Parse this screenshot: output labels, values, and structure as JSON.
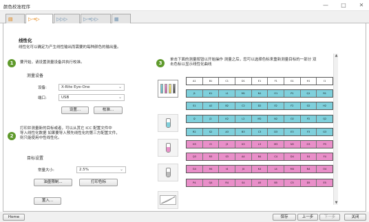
{
  "window": {
    "title": "颜色校准程序",
    "min": "—",
    "max": "□",
    "close": "✕"
  },
  "tabs": [
    {
      "name": "tab-1",
      "text": "▤"
    },
    {
      "name": "tab-2",
      "text": "▷→▷"
    },
    {
      "name": "tab-3",
      "text": "▷▷▷"
    },
    {
      "name": "tab-4",
      "text": "▷→▷▷"
    },
    {
      "name": "tab-5",
      "text": "▦"
    }
  ],
  "page": {
    "title": "线性化",
    "description": "线性化可以确定为产生线性输出而需要的每种颜色的输出量。"
  },
  "step1": {
    "num": "1",
    "text": "要开始，请设置测量设备并执行校准。",
    "section": "测量设备",
    "device_label": "设备:",
    "device_value": "X-Rite Eye-One",
    "port_label": "端口:",
    "port_value": "USB",
    "settings_btn": "设置...",
    "calibrate_btn": "校准..."
  },
  "step2": {
    "num": "2",
    "lines": [
      "打印并测量新的目标或者，可以从其它 ICC 配置文件中",
      "导入线性化数据 如果要导入预先线性化的第三方配置文件，",
      "则只能使用中性线性化。"
    ],
    "section": "目标设置",
    "size_label": "常量大小:",
    "size_value": "2.5%",
    "page_setup_btn": "油墨限制...",
    "print_btn": "打印色标",
    "import_btn": "置入..."
  },
  "step3": {
    "num": "3",
    "lines": [
      "单击下面的测量按钮以开始操作 测量之后，您可以选择色标来重新测量目标的一部分 双",
      "击色标以显示线性化曲线"
    ]
  },
  "target": {
    "rows": [
      {
        "color": "#ffffff",
        "cells": [
          "A1",
          "B1",
          "C1",
          "D1",
          "E1",
          "F1",
          "G1",
          "H1",
          "I1"
        ]
      },
      {
        "color": "#7fd0dc",
        "cells": [
          "J1",
          "K1",
          "L1",
          "M1",
          "N1",
          "O1",
          "P1",
          "Q1",
          "R1"
        ]
      },
      {
        "color": "#7fd0dc",
        "cells": [
          "S1",
          "A2",
          "B2",
          "C2",
          "D2",
          "E2",
          "F2",
          "G2",
          "H2"
        ]
      },
      {
        "color": "#7fd0dc",
        "cells": [
          "I2",
          "J2",
          "K2",
          "L2",
          "M2",
          "N2",
          "O2",
          "P2",
          "Q2"
        ]
      },
      {
        "color": "#7fd0dc",
        "cells": [
          "R2",
          "S2",
          "A3",
          "B3",
          "C3",
          "D3",
          "E3",
          "F3",
          "G3"
        ]
      },
      {
        "color": "#e98fc9",
        "cells": [
          "H3",
          "I3",
          "J3",
          "K3",
          "L3",
          "M3",
          "N3",
          "O3",
          "P3"
        ]
      },
      {
        "color": "#e98fc9",
        "cells": [
          "Q3",
          "R3",
          "S3",
          "A4",
          "B4",
          "C4",
          "D4",
          "E4",
          "F4"
        ]
      },
      {
        "color": "#e98fc9",
        "cells": [
          "G4",
          "H4",
          "I4",
          "J4",
          "K4",
          "L4",
          "M4",
          "N4",
          "O4"
        ]
      },
      {
        "color": "#e98fc9",
        "cells": [
          "P4",
          "Q4",
          "R4",
          "S4",
          "A5",
          "B5",
          "C5",
          "D5",
          "E5"
        ]
      }
    ]
  },
  "bottom": {
    "home": "Home",
    "save": "保存",
    "back": "上一步",
    "next": "下一步",
    "close": "关闭"
  }
}
